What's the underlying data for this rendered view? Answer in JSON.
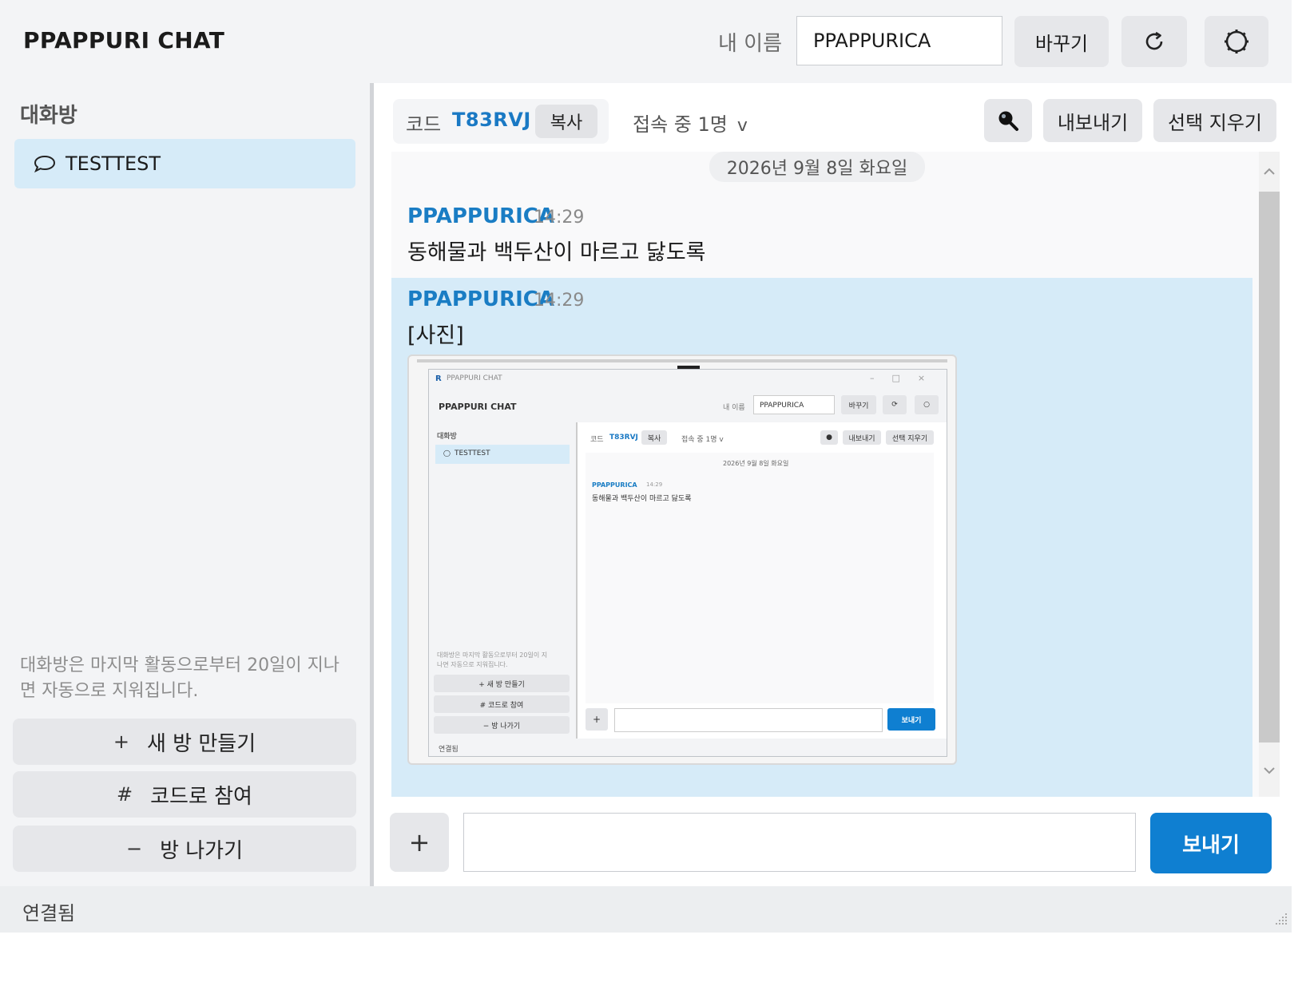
{
  "header": {
    "app_title": "PPAPPURI CHAT",
    "name_label": "내 이름",
    "name_value": "PPAPPURICA",
    "change_label": "바꾸기",
    "refresh_icon": "refresh-icon",
    "settings_icon": "gear-icon"
  },
  "sidebar": {
    "heading": "대화방",
    "rooms": [
      {
        "label": "TESTTEST",
        "icon": "chat-bubble-icon",
        "selected": true
      }
    ],
    "note": "대화방은 마지막 활동으로부터 20일이 지나면 자동으로 지워집니다.",
    "buttons": {
      "new_room": {
        "glyph": "+",
        "label": "새 방 만들기"
      },
      "join_code": {
        "glyph": "#",
        "label": "코드로 참여"
      },
      "leave_room": {
        "glyph": "−",
        "label": "방 나가기"
      }
    }
  },
  "room_bar": {
    "code_label": "코드",
    "code_value": "T83RVJ",
    "copy_label": "복사",
    "online_text": "접속 중 1명",
    "online_chevron": "v",
    "search_icon": "search-icon",
    "export_label": "내보내기",
    "clear_label": "선택 지우기"
  },
  "chat": {
    "date_divider": "2026년 9월 8일 화요일",
    "messages": [
      {
        "author": "PPAPPURICA",
        "time": "14:29",
        "text": "동해물과 백두산이 마르고 닳도록"
      },
      {
        "author": "PPAPPURICA",
        "time": "14:29",
        "text": "[사진]",
        "selected": true,
        "has_image": true
      }
    ]
  },
  "composer": {
    "attach_glyph": "+",
    "input_value": "",
    "send_label": "보내기"
  },
  "status": {
    "text": "연결됨"
  },
  "photo": {
    "window_title": "PPAPPURI CHAT",
    "app_title": "PPAPPURI CHAT",
    "name_label": "내 이름",
    "name_value": "PPAPPURICA",
    "change_label": "바꾸기",
    "sidebar_heading": "대화방",
    "room_label": "TESTTEST",
    "code_label": "코드",
    "code_value": "T83RVJ",
    "copy_label": "복사",
    "online_text": "접속 중 1명 v",
    "export_label": "내보내기",
    "clear_label": "선택 지우기",
    "date_divider": "2026년 9월 8일 화요일",
    "msg_author": "PPAPPURICA",
    "msg_time": "14:29",
    "msg_text": "동해물과 백두산이 마르고 닳도록",
    "note_line1": "대화방은 마지막 활동으로부터 20일이 지",
    "note_line2": "나면 자동으로 지워집니다.",
    "new_room": "+ 새 방 만들기",
    "join_code": "# 코드로 참여",
    "leave_room": "− 방 나가기",
    "attach_glyph": "+",
    "send_label": "보내기",
    "status_text": "연결됨"
  },
  "colors": {
    "accent": "#0f7fd1",
    "author": "#1a7dc4",
    "selected_bg": "#d6ebf8",
    "button_bg": "#e6e7ea"
  }
}
